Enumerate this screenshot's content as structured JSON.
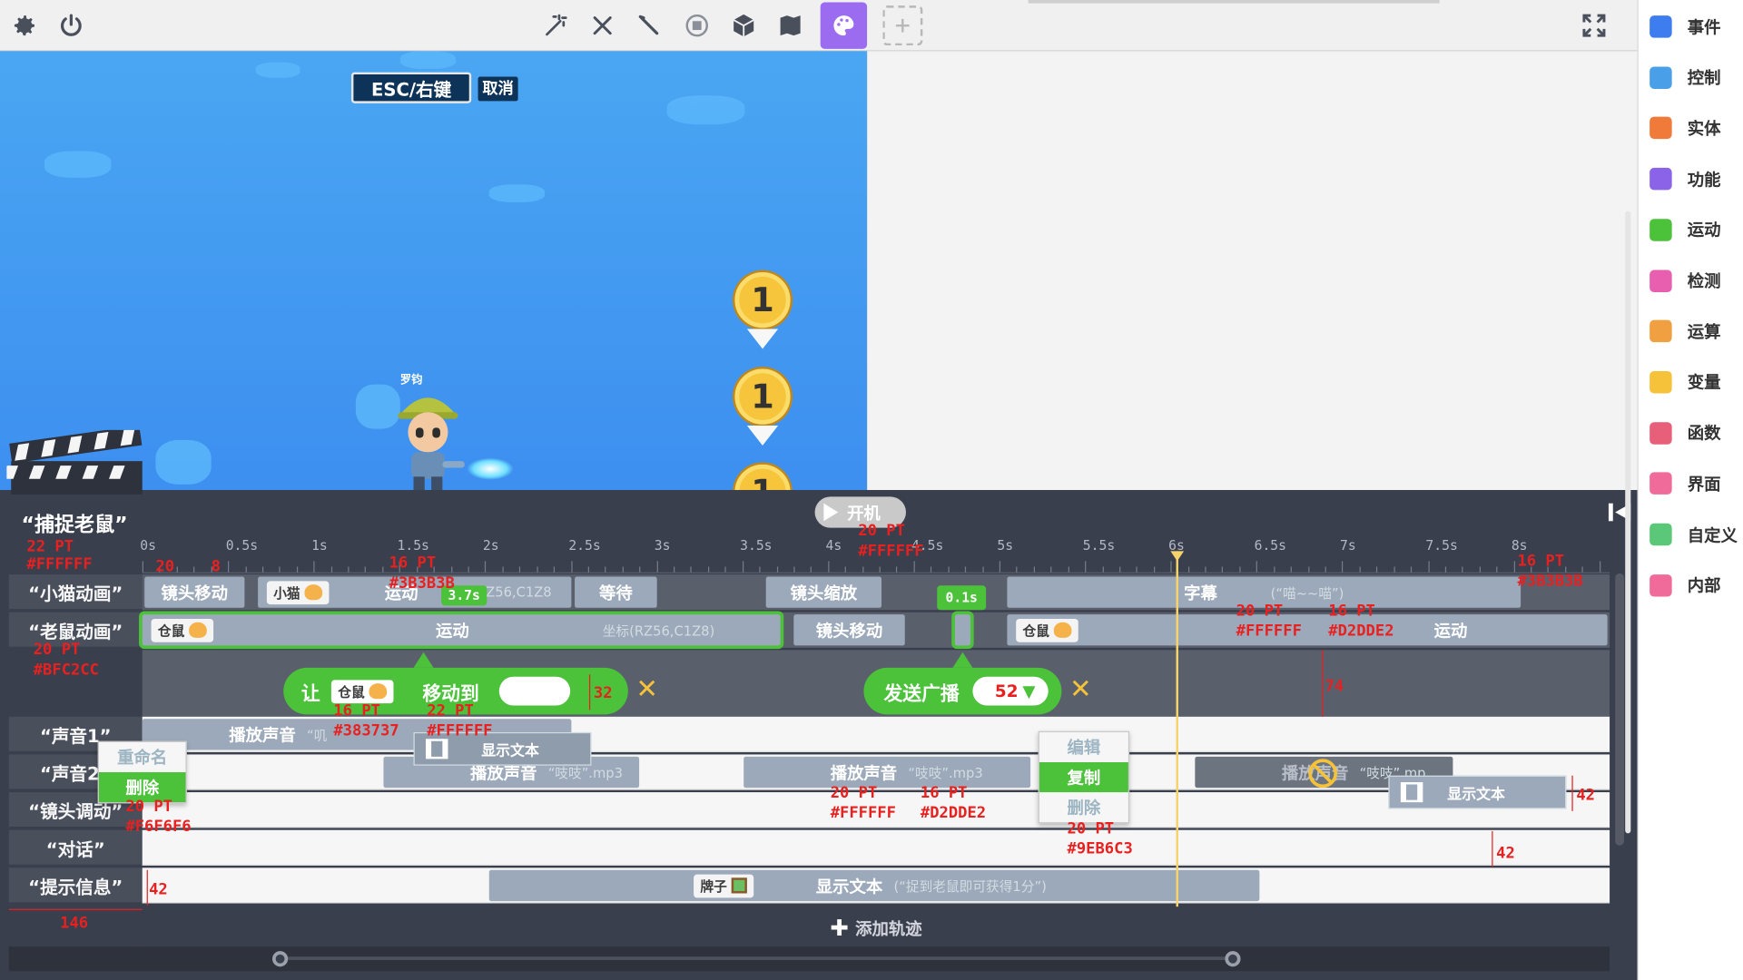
{
  "scene": {
    "esc_key": "ESC/右键",
    "esc_cancel": "取消",
    "npc_name": "罗钧",
    "coin_label": "1"
  },
  "timeline": {
    "title": "“捕捉老鼠”",
    "play_label": "开机",
    "ticks": [
      "0s",
      "0.5s",
      "1s",
      "1.5s",
      "2s",
      "2.5s",
      "3s",
      "3.5s",
      "4s",
      "4.5s",
      "5s",
      "5.5s",
      "6s",
      "6.5s",
      "7s",
      "7.5s",
      "8s"
    ],
    "tracks": [
      {
        "name": "“小猫动画”"
      },
      {
        "name": "“老鼠动画”"
      },
      {
        "name": "“声音1”"
      },
      {
        "name": "“声音2”"
      },
      {
        "name": "“镜头调动”"
      },
      {
        "name": "“对话”"
      },
      {
        "name": "“提示信息”"
      }
    ],
    "cat_track": {
      "clip1": "镜头移动",
      "chip": "小猫",
      "clip2": "运动",
      "badge": "3.7s",
      "clip2_sub": "(RZ56,C1Z8",
      "clip3": "等待",
      "clip4": "镜头缩放",
      "clip5": "字幕",
      "clip5_sub": "(“喵~~喵”)",
      "time_badge": "0.1s"
    },
    "mouse_track": {
      "chip": "仓鼠",
      "clip1": "运动",
      "clip1_sub": "坐标(RZ56,C1Z8)",
      "clip2": "镜头移动",
      "chip2": "仓鼠",
      "clip3": "运动"
    },
    "move_bar": {
      "let": "让",
      "chip": "仓鼠",
      "move_to": "移动到"
    },
    "broadcast_bar": {
      "label": "发送广播",
      "value": "52"
    },
    "sound1": {
      "clip": "播放声音",
      "sub": "“叽"
    },
    "sound2": {
      "clip1": "播放声音",
      "clip1_sub": "“吱吱”.mp3",
      "clip2": "播放声音",
      "clip2_sub": "“吱吱”.mp3",
      "clip3": "播放声音",
      "clip3_sub": "“吱吱”.mp"
    },
    "drag_text1": "显示文本",
    "drag_text2": "显示文本",
    "hint": {
      "chip": "牌子",
      "clip": "显示文本",
      "sub": "(“捉到老鼠即可获得1分”)"
    },
    "ctx_left": {
      "rename": "重命名",
      "delete": "删除"
    },
    "ctx_right": {
      "edit": "编辑",
      "copy": "复制",
      "delete": "删除"
    },
    "add_track": "添加轨迹"
  },
  "annotations": {
    "a1": "22 PT",
    "a2": "#FFFFFF",
    "a3": "20",
    "a4": "8",
    "a5": "16 PT",
    "a6": "#3B3B3B",
    "a7": "20 PT",
    "a8": "#FFFFFF",
    "a9": "16 PT",
    "a10": "#3B3B3B",
    "a11": "20 PT",
    "a12": "#FFFFFF",
    "a13": "16 PT",
    "a14": "#D2DDE2",
    "a15": "20 PT",
    "a16": "#BFC2CC",
    "a17": "32",
    "a18": "74",
    "a19": "16 PT",
    "a20": "#383737",
    "a21": "22 PT",
    "a22": "#FFFFFF",
    "a23": "20 PT",
    "a24": "#F6F6F6",
    "a25": "20 PT",
    "a26": "#FFFFFF",
    "a27": "16 PT",
    "a28": "#D2DDE2",
    "a29": "20 PT",
    "a30": "#9EB6C3",
    "a31": "42",
    "a32": "42",
    "a33": "42",
    "a34": "146"
  },
  "sidebar": {
    "items": [
      {
        "label": "事件",
        "icon": "play-circle-icon",
        "color": "#3d7df0"
      },
      {
        "label": "控制",
        "icon": "gamepad-icon",
        "color": "#4aa0e8"
      },
      {
        "label": "实体",
        "icon": "gift-icon",
        "color": "#f07a3a"
      },
      {
        "label": "功能",
        "icon": "wrench-icon",
        "color": "#8a63e8"
      },
      {
        "label": "运动",
        "icon": "shoe-icon",
        "color": "#4cc13a"
      },
      {
        "label": "检测",
        "icon": "detect-icon",
        "color": "#e85fb0"
      },
      {
        "label": "运算",
        "icon": "grid-icon",
        "color": "#f0a040"
      },
      {
        "label": "变量",
        "icon": "bar-chart-icon",
        "color": "#f5c23a"
      },
      {
        "label": "函数",
        "icon": "function-icon",
        "color": "#e85f7a"
      },
      {
        "label": "界面",
        "icon": "ui-icon",
        "color": "#f06a9a"
      },
      {
        "label": "自定义",
        "icon": "pencil-icon",
        "color": "#5ac878"
      },
      {
        "label": "内部",
        "icon": "ui-internal-icon",
        "color": "#f06a9a"
      }
    ]
  }
}
